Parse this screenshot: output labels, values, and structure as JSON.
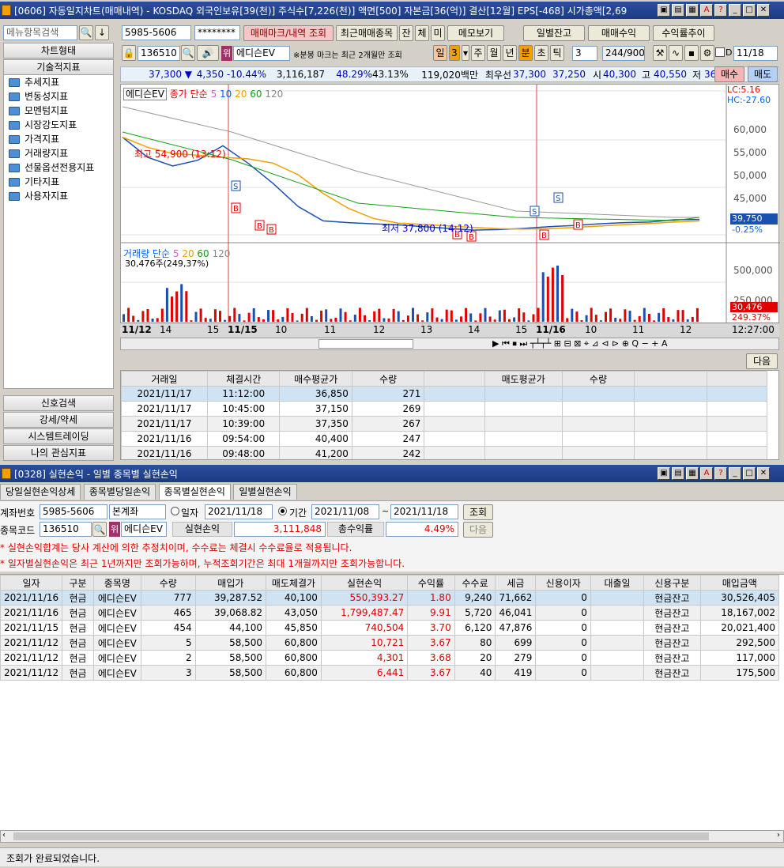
{
  "top_window": {
    "title": "[0606] 자동일지차트(매매내역) - KOSDAQ 외국인보유[39(천)] 주식수[7,226(천)] 액면[500] 자본금[36(억)] 결산[12월] EPS[-468] 시가총액[2,69"
  },
  "sidebar": {
    "search_placeholder": "메뉴항목검색",
    "chart_type": "차트형태",
    "tech_indicator": "기술적지표",
    "tree": [
      "추세지표",
      "변동성지표",
      "모멘텀지표",
      "시장강도지표",
      "가격지표",
      "거래량지표",
      "선물옵션전용지표",
      "기타지표",
      "사용자지표"
    ],
    "bottom": [
      "신호검색",
      "강세/약세",
      "시스템트레이딩",
      "나의 관심지표"
    ]
  },
  "toolbar": {
    "account": "5985-5606",
    "password": "********",
    "mark_btn": "매매마크/내역 조회",
    "recent_btn": "최근매매종목",
    "jan": "잔",
    "che": "체",
    "mi": "미",
    "memo_btn": "메모보기",
    "daily_balance_btn": "일별잔고",
    "trade_profit_btn": "매매수익",
    "return_trend_btn": "수익률추이",
    "code": "136510",
    "stock_name": "에디슨EV",
    "note": "※분봉 마크는 최근 2개월만 조회",
    "periods": [
      "일",
      "3",
      "주",
      "월",
      "년",
      "분",
      "초",
      "틱"
    ],
    "tick_val": "3",
    "count": "244",
    "count_max": "/900",
    "date": "11/18"
  },
  "quote": {
    "price": "37,300 ▼",
    "change": "4,350 -10.44%",
    "volume": "3,116,187",
    "r1": "48.29%",
    "r2": "43.13%",
    "amount": "119,020백만",
    "label_ask": "최우선",
    "ask": "37,300",
    "bid": "37,250",
    "open_l": "시",
    "open": "40,300",
    "high_l": "고",
    "high": "40,550",
    "low_l": "저",
    "low": "36,300",
    "buy_btn": "매수",
    "sell_btn": "매도"
  },
  "chart": {
    "legend_name": "에디슨EV",
    "legend_series": "종가 단순",
    "ma": [
      "5",
      "10",
      "20",
      "60",
      "120"
    ],
    "lc": "LC:5.16",
    "hc": "HC:-27.60",
    "yticks": [
      "60,000",
      "55,000",
      "50,000",
      "45,000"
    ],
    "high_label": "최고 54,900 (13:12)",
    "low_label": "최저 37,800 (14:12)",
    "last_price": "39,750",
    "last_pct": "-0.25%",
    "vol_legend": "거래량 단순",
    "vol_ma": [
      "5",
      "20",
      "60",
      "120"
    ],
    "vol_value": "30,476주(249,37%)",
    "vol_yticks": [
      "500,000",
      "250,000"
    ],
    "vol_last": "30,476",
    "vol_pct": "249.37%",
    "xticks": [
      "11/12",
      "14",
      "15",
      "11/15",
      "10",
      "11",
      "12",
      "13",
      "14",
      "15",
      "11/16",
      "10",
      "11",
      "12"
    ],
    "time": "12:27:00"
  },
  "chart_data": {
    "type": "line",
    "title": "에디슨EV",
    "series": [
      {
        "name": "종가",
        "values": [
          54000,
          50500,
          49000,
          50000,
          52500,
          49500,
          46000,
          42000,
          39500,
          39200,
          39000,
          38800,
          38500,
          38200,
          37900,
          38000,
          38200,
          38500,
          38700,
          39000,
          39200,
          39300,
          39700,
          39750
        ]
      }
    ]
  },
  "trade_table": {
    "next_btn": "다음",
    "headers": [
      "거래일",
      "체결시간",
      "매수평균가",
      "수량",
      "",
      "매도평균가",
      "수량",
      "",
      ""
    ],
    "rows": [
      [
        "2021/11/17",
        "11:12:00",
        "36,850",
        "271"
      ],
      [
        "2021/11/17",
        "10:45:00",
        "37,150",
        "269"
      ],
      [
        "2021/11/17",
        "10:39:00",
        "37,350",
        "267"
      ],
      [
        "2021/11/16",
        "09:54:00",
        "40,400",
        "247"
      ],
      [
        "2021/11/16",
        "09:48:00",
        "41,200",
        "242"
      ]
    ]
  },
  "bottom_window": {
    "title": "[0328] 실현손익 - 일별 종목별 실현손익",
    "tabs": [
      "당일실현손익상세",
      "종목별당일손익",
      "종목별실현손익",
      "일별실현손익"
    ],
    "account_label": "계좌번호",
    "account": "5985-5606",
    "account_type": "본계좌",
    "date_radio": "일자",
    "date": "2021/11/18",
    "period_radio": "기간",
    "from": "2021/11/08",
    "to": "2021/11/18",
    "query_btn": "조회",
    "code_label": "종목코드",
    "code": "136510",
    "stock_name": "에디슨EV",
    "realized_label": "실현손익",
    "realized": "3,111,848",
    "total_return_label": "총수익률",
    "total_return": "4.49%",
    "next_btn": "다음",
    "notice1": "* 실현손익합계는 당사 계산에 의한 추정치이며, 수수료는 체결시 수수료율로 적용됩니다.",
    "notice2": "* 일자별실현손익은 최근 1년까지만 조회가능하며, 누적조회기간은 최대 1개월까지만 조회가능합니다.",
    "headers": [
      "일자",
      "구분",
      "종목명",
      "수량",
      "매입가",
      "매도체결가",
      "실현손익",
      "수익률",
      "수수료",
      "세금",
      "신용이자",
      "대출일",
      "신용구분",
      "매입금액"
    ],
    "rows": [
      [
        "2021/11/16",
        "현금",
        "에디슨EV",
        "777",
        "39,287.52",
        "40,100",
        "550,393.27",
        "1.80",
        "9,240",
        "71,662",
        "0",
        "",
        "현금잔고",
        "30,526,405"
      ],
      [
        "2021/11/16",
        "현금",
        "에디슨EV",
        "465",
        "39,068.82",
        "43,050",
        "1,799,487.47",
        "9.91",
        "5,720",
        "46,041",
        "0",
        "",
        "현금잔고",
        "18,167,002"
      ],
      [
        "2021/11/15",
        "현금",
        "에디슨EV",
        "454",
        "44,100",
        "45,850",
        "740,504",
        "3.70",
        "6,120",
        "47,876",
        "0",
        "",
        "현금잔고",
        "20,021,400"
      ],
      [
        "2021/11/12",
        "현금",
        "에디슨EV",
        "5",
        "58,500",
        "60,800",
        "10,721",
        "3.67",
        "80",
        "699",
        "0",
        "",
        "현금잔고",
        "292,500"
      ],
      [
        "2021/11/12",
        "현금",
        "에디슨EV",
        "2",
        "58,500",
        "60,800",
        "4,301",
        "3.68",
        "20",
        "279",
        "0",
        "",
        "현금잔고",
        "117,000"
      ],
      [
        "2021/11/12",
        "현금",
        "에디슨EV",
        "3",
        "58,500",
        "60,800",
        "6,441",
        "3.67",
        "40",
        "419",
        "0",
        "",
        "현금잔고",
        "175,500"
      ]
    ],
    "status": "조회가 완료되었습니다."
  },
  "colors": {
    "title_bg": "#1c3b84",
    "red": "#e00000",
    "blue": "#0000cc"
  }
}
